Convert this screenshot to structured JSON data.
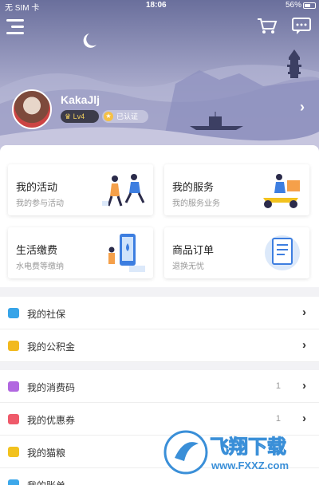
{
  "status_bar": {
    "carrier": "无 SIM 卡",
    "time": "18:06",
    "battery": "56%"
  },
  "header": {
    "username": "KakaJlj",
    "level_badge": "Lv4",
    "certified_badge": "已认证",
    "arrow": "›"
  },
  "cards": [
    {
      "title": "我的活动",
      "sub": "我的参与活动"
    },
    {
      "title": "我的服务",
      "sub": "我的服务业务"
    },
    {
      "title": "生活缴费",
      "sub": "水电费等缴纳"
    },
    {
      "title": "商品订单",
      "sub": "退换无忧"
    }
  ],
  "list_group1": [
    {
      "label": "我的社保",
      "icon": "social-security-icon",
      "color": "#37a4e8"
    },
    {
      "label": "我的公积金",
      "icon": "housing-fund-icon",
      "color": "#f2b91e"
    }
  ],
  "list_group2": [
    {
      "label": "我的消费码",
      "icon": "consume-code-icon",
      "color": "#b167e0",
      "count": "1"
    },
    {
      "label": "我的优惠券",
      "icon": "coupon-icon",
      "color": "#ef5a6a",
      "count": "1"
    },
    {
      "label": "我的猫粮",
      "icon": "cat-food-icon",
      "color": "#f2c21e",
      "count": ""
    },
    {
      "label": "我的账单",
      "icon": "bill-icon",
      "color": "#3da8ea",
      "count": ""
    }
  ],
  "watermark": {
    "brand": "飞翔下载",
    "url": "www.FXXZ.com"
  },
  "colors": {
    "hero_top": "#6a6f9c",
    "accent": "#37a4e8"
  }
}
